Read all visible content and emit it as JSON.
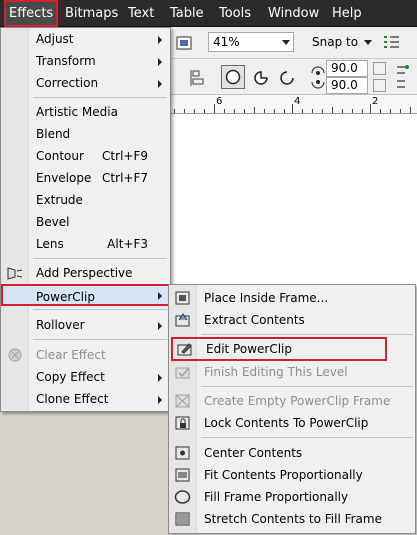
{
  "menubar": {
    "items": [
      {
        "label": "Effects",
        "underline": "E"
      },
      {
        "label": "Bitmaps",
        "underline": "B"
      },
      {
        "label": "Text",
        "underline": "x"
      },
      {
        "label": "Table",
        "underline": "T"
      },
      {
        "label": "Tools",
        "underline": "o"
      },
      {
        "label": "Window",
        "underline": "W"
      },
      {
        "label": "Help",
        "underline": "H"
      }
    ]
  },
  "toolbar": {
    "zoom_value": "41%",
    "snap_label": "Snap to",
    "angle1": "90.0",
    "angle2": "90.0"
  },
  "ruler": {
    "labels": [
      "6",
      "4",
      "2"
    ]
  },
  "effects_menu": {
    "items": [
      {
        "label": "Adjust",
        "submenu": true
      },
      {
        "label": "Transform",
        "submenu": true
      },
      {
        "label": "Correction",
        "submenu": true
      },
      {
        "label": "Artistic Media"
      },
      {
        "label": "Blend"
      },
      {
        "label": "Contour",
        "shortcut": "Ctrl+F9"
      },
      {
        "label": "Envelope",
        "shortcut": "Ctrl+F7"
      },
      {
        "label": "Extrude"
      },
      {
        "label": "Bevel"
      },
      {
        "label": "Lens",
        "shortcut": "Alt+F3"
      },
      {
        "label": "Add Perspective"
      },
      {
        "label": "PowerClip",
        "submenu": true
      },
      {
        "label": "Rollover",
        "submenu": true
      },
      {
        "label": "Clear Effect",
        "disabled": true
      },
      {
        "label": "Copy Effect",
        "submenu": true
      },
      {
        "label": "Clone Effect",
        "submenu": true
      }
    ]
  },
  "powerclip_menu": {
    "items": [
      {
        "label": "Place Inside Frame..."
      },
      {
        "label": "Extract Contents"
      },
      {
        "label": "Edit PowerClip"
      },
      {
        "label": "Finish Editing This Level",
        "disabled": true
      },
      {
        "label": "Create Empty PowerClip Frame",
        "disabled": true
      },
      {
        "label": "Lock Contents To PowerClip"
      },
      {
        "label": "Center Contents"
      },
      {
        "label": "Fit Contents Proportionally"
      },
      {
        "label": "Fill Frame Proportionally"
      },
      {
        "label": "Stretch Contents to Fill Frame"
      }
    ]
  },
  "colors": {
    "menubar_bg": "#2b2b2b",
    "highlight_border": "#d2202f",
    "menu_bg": "#f0f0f0",
    "hover_bg": "#d6e4f5"
  }
}
